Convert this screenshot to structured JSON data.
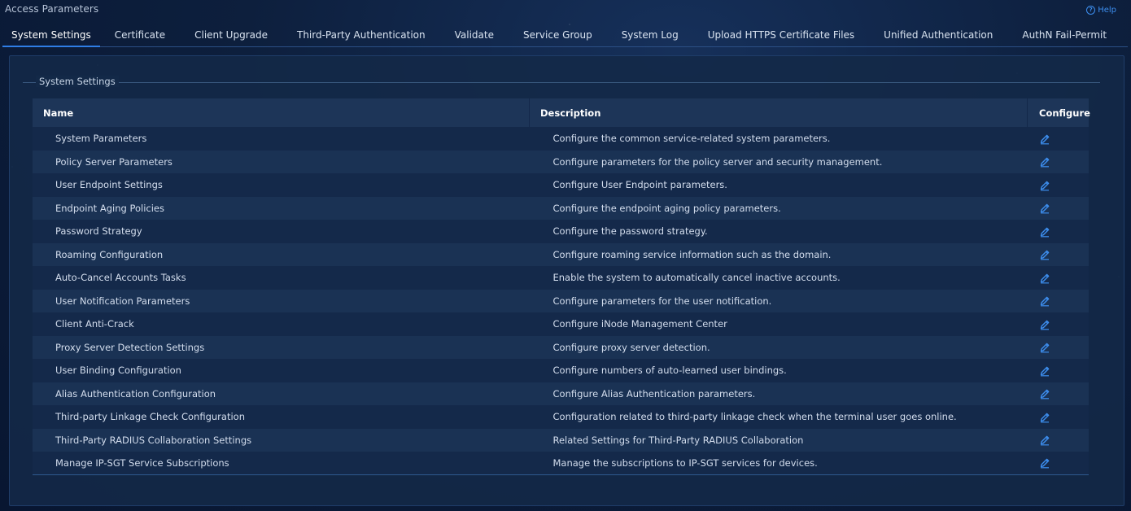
{
  "page": {
    "title": "Access Parameters",
    "help_label": "Help"
  },
  "tabs": [
    {
      "label": "System Settings",
      "active": true
    },
    {
      "label": "Certificate"
    },
    {
      "label": "Client Upgrade"
    },
    {
      "label": "Third-Party Authentication"
    },
    {
      "label": "Validate"
    },
    {
      "label": "Service Group"
    },
    {
      "label": "System Log"
    },
    {
      "label": "Upload HTTPS Certificate Files"
    },
    {
      "label": "Unified Authentication"
    },
    {
      "label": "AuthN Fail-Permit"
    }
  ],
  "section": {
    "legend": "System Settings"
  },
  "table": {
    "headers": {
      "name": "Name",
      "description": "Description",
      "configure": "Configure"
    },
    "rows": [
      {
        "name": "System Parameters",
        "description": "Configure the common service-related system parameters."
      },
      {
        "name": "Policy Server Parameters",
        "description": "Configure parameters for the policy server and security management."
      },
      {
        "name": "User Endpoint Settings",
        "description": "Configure User Endpoint parameters."
      },
      {
        "name": "Endpoint Aging Policies",
        "description": "Configure the endpoint aging policy parameters."
      },
      {
        "name": "Password Strategy",
        "description": "Configure the password strategy."
      },
      {
        "name": "Roaming Configuration",
        "description": "Configure roaming service information such as the domain."
      },
      {
        "name": "Auto-Cancel Accounts Tasks",
        "description": "Enable the system to automatically cancel inactive accounts."
      },
      {
        "name": "User Notification Parameters",
        "description": "Configure parameters for the user notification."
      },
      {
        "name": "Client Anti-Crack",
        "description": "Configure iNode Management Center"
      },
      {
        "name": "Proxy Server Detection Settings",
        "description": "Configure proxy server detection."
      },
      {
        "name": "User Binding Configuration",
        "description": "Configure numbers of auto-learned user bindings."
      },
      {
        "name": "Alias Authentication Configuration",
        "description": "Configure Alias Authentication parameters."
      },
      {
        "name": "Third-party Linkage Check Configuration",
        "description": "Configuration related to third-party linkage check when the terminal user goes online."
      },
      {
        "name": "Third-Party RADIUS Collaboration Settings",
        "description": "Related Settings for Third-Party RADIUS Collaboration"
      },
      {
        "name": "Manage IP-SGT Service Subscriptions",
        "description": "Manage the subscriptions to IP-SGT services for devices."
      }
    ]
  },
  "icons": {
    "configure": "edit-pencil-icon",
    "help": "help-circle-icon"
  },
  "colors": {
    "accent": "#2f7ee6",
    "link": "#3d8ff0"
  }
}
